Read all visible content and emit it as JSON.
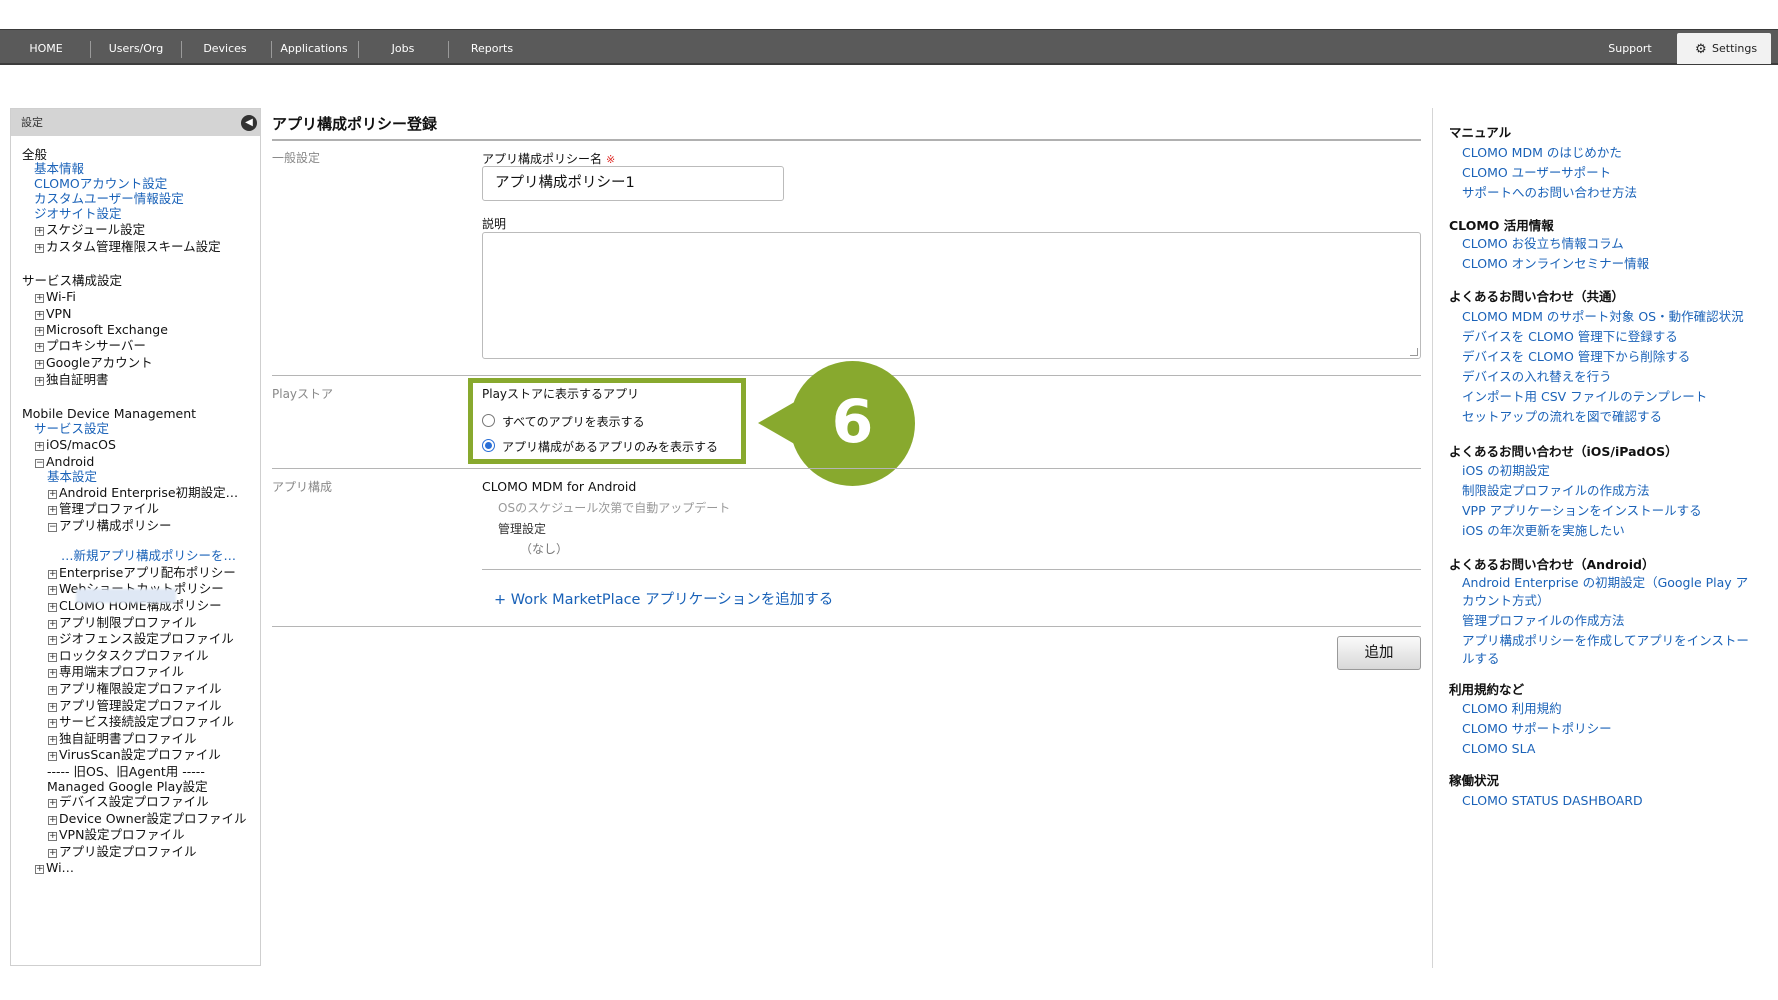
{
  "nav": {
    "items": [
      "HOME",
      "Users/Org",
      "Devices",
      "Applications",
      "Jobs",
      "Reports"
    ],
    "support": "Support",
    "settings": "Settings"
  },
  "sidebar": {
    "header": "設定",
    "lines": [
      {
        "text": "全般",
        "kind": "head"
      },
      {
        "text": "基本情報",
        "kind": "link"
      },
      {
        "text": "CLOMOアカウント設定",
        "kind": "link"
      },
      {
        "text": "カスタムユーザー情報設定",
        "kind": "link"
      },
      {
        "text": "ジオサイト設定",
        "kind": "link"
      },
      {
        "text": "スケジュール設定",
        "kind": "exp"
      },
      {
        "text": "カスタム管理権限スキーム設定",
        "kind": "exp"
      },
      {
        "text": "サービス構成設定",
        "kind": "head"
      },
      {
        "text": "Wi-Fi",
        "kind": "exp"
      },
      {
        "text": "VPN",
        "kind": "exp"
      },
      {
        "text": "Microsoft Exchange",
        "kind": "exp"
      },
      {
        "text": "プロキシサーバー",
        "kind": "exp"
      },
      {
        "text": "Googleアカウント",
        "kind": "exp"
      },
      {
        "text": "独自証明書",
        "kind": "exp"
      },
      {
        "text": "Mobile Device Management",
        "kind": "head"
      },
      {
        "text": "サービス設定",
        "kind": "link"
      },
      {
        "text": "iOS/macOS",
        "kind": "exp"
      },
      {
        "text": "Android",
        "kind": "col"
      },
      {
        "text": "基本設定",
        "kind": "link2"
      },
      {
        "text": "Android Enterprise初期設定…",
        "kind": "exp2"
      },
      {
        "text": "管理プロファイル",
        "kind": "exp2"
      },
      {
        "text": "アプリ構成ポリシー",
        "kind": "col2"
      },
      {
        "text": "…新規アプリ構成ポリシーを…",
        "kind": "link3"
      },
      {
        "text": "Enterpriseアプリ配布ポリシー",
        "kind": "exp2"
      },
      {
        "text": "Webショートカットポリシー",
        "kind": "exp2"
      },
      {
        "text": "CLOMO HOME構成ポリシー",
        "kind": "exp2"
      },
      {
        "text": "アプリ制限プロファイル",
        "kind": "exp2"
      },
      {
        "text": "ジオフェンス設定プロファイル",
        "kind": "exp2"
      },
      {
        "text": "ロックタスクプロファイル",
        "kind": "exp2"
      },
      {
        "text": "専用端末プロファイル",
        "kind": "exp2"
      },
      {
        "text": "アプリ権限設定プロファイル",
        "kind": "exp2"
      },
      {
        "text": "アプリ管理設定プロファイル",
        "kind": "exp2"
      },
      {
        "text": "サービス接続設定プロファイル",
        "kind": "exp2"
      },
      {
        "text": "独自証明書プロファイル",
        "kind": "exp2"
      },
      {
        "text": "VirusScan設定プロファイル",
        "kind": "exp2"
      },
      {
        "text": "----- 旧OS、旧Agent用 -----",
        "kind": "plain2"
      },
      {
        "text": "Managed Google Play設定",
        "kind": "plain2"
      },
      {
        "text": "デバイス設定プロファイル",
        "kind": "exp2"
      },
      {
        "text": "Device Owner設定プロファイル",
        "kind": "exp2"
      },
      {
        "text": "VPN設定プロファイル",
        "kind": "exp2"
      },
      {
        "text": "アプリ設定プロファイル",
        "kind": "exp2"
      },
      {
        "text": "Wi…",
        "kind": "exp"
      }
    ]
  },
  "main": {
    "title": "アプリ構成ポリシー登録",
    "general_label": "一般設定",
    "policy_name_label": "アプリ構成ポリシー名",
    "required_mark": "※",
    "policy_name_value": "アプリ構成ポリシー1",
    "description_label": "説明",
    "description_value": "",
    "playstore_label": "Playストア",
    "playstore_title": "Playストアに表示するアプリ",
    "radio_all": "すべてのアプリを表示する",
    "radio_config": "アプリ構成があるアプリのみを表示する",
    "radio_selected": "radio_config",
    "step_badge": "6",
    "appconfig_label": "アプリ構成",
    "app_name": "CLOMO MDM for Android",
    "app_update_note": "OSのスケジュール次第で自動アップデート",
    "managed_config_label": "管理設定",
    "managed_config_value": "（なし）",
    "add_workmarketplace": "+ Work MarketPlace アプリケーションを追加する",
    "add_button": "追加"
  },
  "help": {
    "sections": [
      {
        "title": "マニュアル",
        "links": [
          "CLOMO MDM のはじめかた",
          "CLOMO ユーザーサポート",
          "サポートへのお問い合わせ方法"
        ]
      },
      {
        "title": "CLOMO 活用情報",
        "links": [
          "CLOMO お役立ち情報コラム",
          "CLOMO オンラインセミナー情報"
        ]
      },
      {
        "title": "よくあるお問い合わせ（共通）",
        "links": [
          "CLOMO MDM のサポート対象 OS・動作確認状況",
          "デバイスを CLOMO 管理下に登録する",
          "デバイスを CLOMO 管理下から削除する",
          "デバイスの入れ替えを行う",
          "インポート用 CSV ファイルのテンプレート",
          "セットアップの流れを図で確認する"
        ]
      },
      {
        "title": "よくあるお問い合わせ（iOS/iPadOS）",
        "links": [
          "iOS の初期設定",
          "制限設定プロファイルの作成方法",
          "VPP アプリケーションをインストールする",
          "iOS の年次更新を実施したい"
        ]
      },
      {
        "title": "よくあるお問い合わせ（Android）",
        "links": [
          "Android Enterprise の初期設定（Google Play ア",
          "カウント方式）",
          "管理プロファイルの作成方法",
          "アプリ構成ポリシーを作成してアプリをインストー",
          "ルする"
        ]
      },
      {
        "title": "利用規約など",
        "links": [
          "CLOMO 利用規約",
          "CLOMO サポートポリシー",
          "CLOMO SLA"
        ]
      },
      {
        "title": "稼働状況",
        "links": [
          "CLOMO STATUS DASHBOARD"
        ]
      }
    ]
  }
}
